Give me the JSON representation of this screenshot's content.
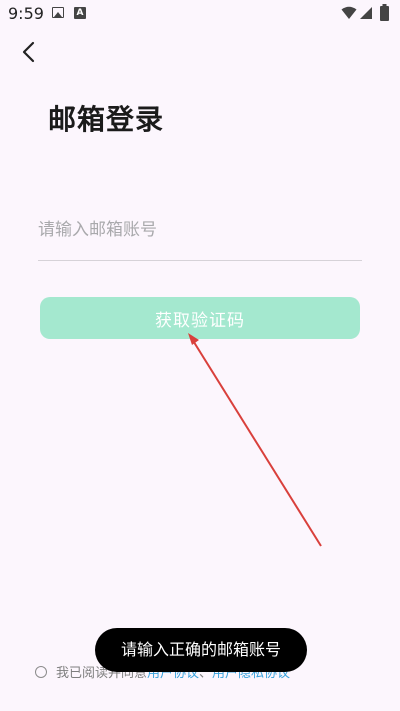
{
  "status_bar": {
    "time": "9:59"
  },
  "page": {
    "title": "邮箱登录"
  },
  "email": {
    "placeholder": "请输入邮箱账号",
    "value": ""
  },
  "get_code_button": {
    "label": "获取验证码"
  },
  "agreement": {
    "prefix": "我已阅读并同意",
    "user_agreement": "用户协议",
    "separator": "、",
    "privacy_agreement": "用户隐私协议"
  },
  "toast": {
    "message": "请输入正确的邮箱账号"
  },
  "colors": {
    "background": "#fcf6fd",
    "button": "#a4e8cf",
    "link": "#3aa3dc",
    "annotation_arrow": "#d9403c"
  }
}
